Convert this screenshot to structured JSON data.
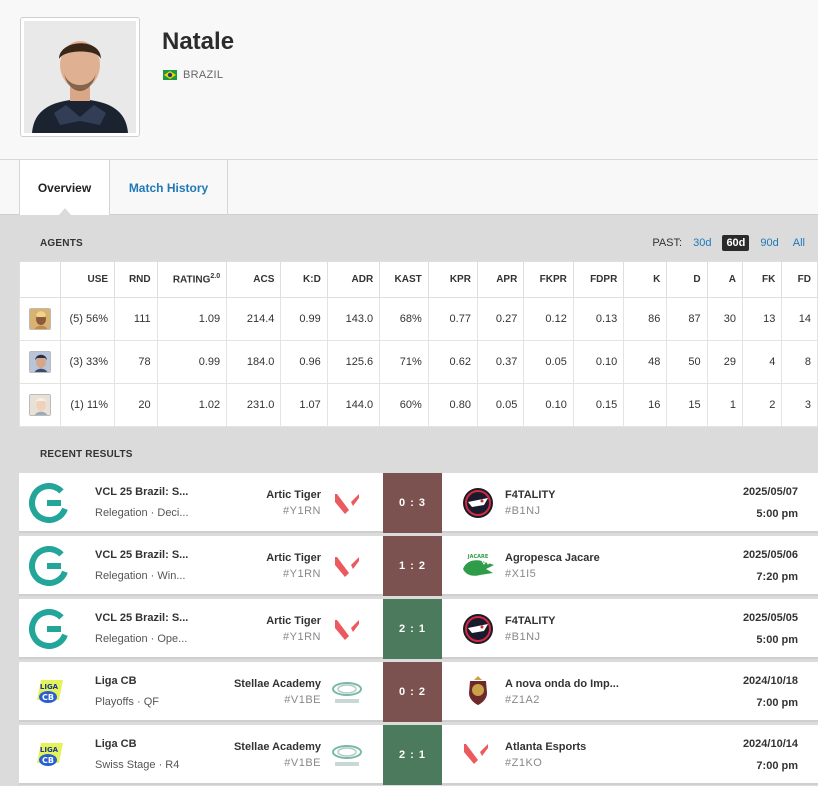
{
  "player": {
    "name": "Natale",
    "country": "BRAZIL",
    "colors": {
      "flag_green": "#1a9c3e",
      "flag_yellow": "#f7d300",
      "flag_blue": "#1f3c8c"
    }
  },
  "tabs": [
    {
      "label": "Overview",
      "active": true
    },
    {
      "label": "Match History",
      "active": false
    }
  ],
  "agents_section": {
    "title": "AGENTS",
    "past_label": "PAST:",
    "past_options": [
      {
        "label": "30d",
        "active": false
      },
      {
        "label": "60d",
        "active": true
      },
      {
        "label": "90d",
        "active": false
      },
      {
        "label": "All",
        "active": false
      }
    ],
    "columns": [
      "USE",
      "RND",
      "RATING",
      "ACS",
      "K:D",
      "ADR",
      "KAST",
      "KPR",
      "APR",
      "FKPR",
      "FDPR",
      "K",
      "D",
      "A",
      "FK",
      "FD"
    ],
    "rating_sup": "2.0",
    "rows": [
      {
        "icon": "agent-portrait-1-icon",
        "cells": [
          "(5) 56%",
          "111",
          "1.09",
          "214.4",
          "0.99",
          "143.0",
          "68%",
          "0.77",
          "0.27",
          "0.12",
          "0.13",
          "86",
          "87",
          "30",
          "13",
          "14"
        ]
      },
      {
        "icon": "agent-portrait-2-icon",
        "cells": [
          "(3) 33%",
          "78",
          "0.99",
          "184.0",
          "0.96",
          "125.6",
          "71%",
          "0.62",
          "0.37",
          "0.05",
          "0.10",
          "48",
          "50",
          "29",
          "4",
          "8"
        ]
      },
      {
        "icon": "agent-portrait-3-icon",
        "cells": [
          "(1) 11%",
          "20",
          "1.02",
          "231.0",
          "1.07",
          "144.0",
          "60%",
          "0.80",
          "0.05",
          "0.10",
          "0.15",
          "16",
          "15",
          "1",
          "2",
          "3"
        ]
      }
    ]
  },
  "results_section": {
    "title": "RECENT RESULTS",
    "rows": [
      {
        "event": "VCL 25 Brazil: S...",
        "stage": "Relegation · Deci...",
        "event_icon": "gamers-club-logo-icon",
        "team1": "Artic Tiger",
        "team1_tag": "#Y1RN",
        "team1_logo": "valorant-logo-icon",
        "score": "0 : 3",
        "result": "loss",
        "team2": "F4TALITY",
        "team2_tag": "#B1NJ",
        "team2_logo": "f4tality-logo-icon",
        "date": "2025/05/07",
        "time": "5:00 pm"
      },
      {
        "event": "VCL 25 Brazil: S...",
        "stage": "Relegation · Win...",
        "event_icon": "gamers-club-logo-icon",
        "team1": "Artic Tiger",
        "team1_tag": "#Y1RN",
        "team1_logo": "valorant-logo-icon",
        "score": "1 : 2",
        "result": "loss",
        "team2": "Agropesca Jacare",
        "team2_tag": "#X1I5",
        "team2_logo": "jacare-logo-icon",
        "date": "2025/05/06",
        "time": "7:20 pm"
      },
      {
        "event": "VCL 25 Brazil: S...",
        "stage": "Relegation · Ope...",
        "event_icon": "gamers-club-logo-icon",
        "team1": "Artic Tiger",
        "team1_tag": "#Y1RN",
        "team1_logo": "valorant-logo-icon",
        "score": "2 : 1",
        "result": "win",
        "team2": "F4TALITY",
        "team2_tag": "#B1NJ",
        "team2_logo": "f4tality-logo-icon",
        "date": "2025/05/05",
        "time": "5:00 pm"
      },
      {
        "event": "Liga CB",
        "stage": "Playoffs · QF",
        "event_icon": "liga-cb-logo-icon",
        "team1": "Stellae Academy",
        "team1_tag": "#V1BE",
        "team1_logo": "stellae-logo-icon",
        "score": "0 : 2",
        "result": "loss",
        "team2": "A nova onda do Imp...",
        "team2_tag": "#Z1A2",
        "team2_logo": "crest-logo-icon",
        "date": "2024/10/18",
        "time": "7:00 pm"
      },
      {
        "event": "Liga CB",
        "stage": "Swiss Stage · R4",
        "event_icon": "liga-cb-logo-icon",
        "team1": "Stellae Academy",
        "team1_tag": "#V1BE",
        "team1_logo": "stellae-logo-icon",
        "score": "2 : 1",
        "result": "win",
        "team2": "Atlanta Esports",
        "team2_tag": "#Z1KO",
        "team2_logo": "valorant-logo-icon",
        "date": "2024/10/14",
        "time": "7:00 pm"
      }
    ]
  }
}
